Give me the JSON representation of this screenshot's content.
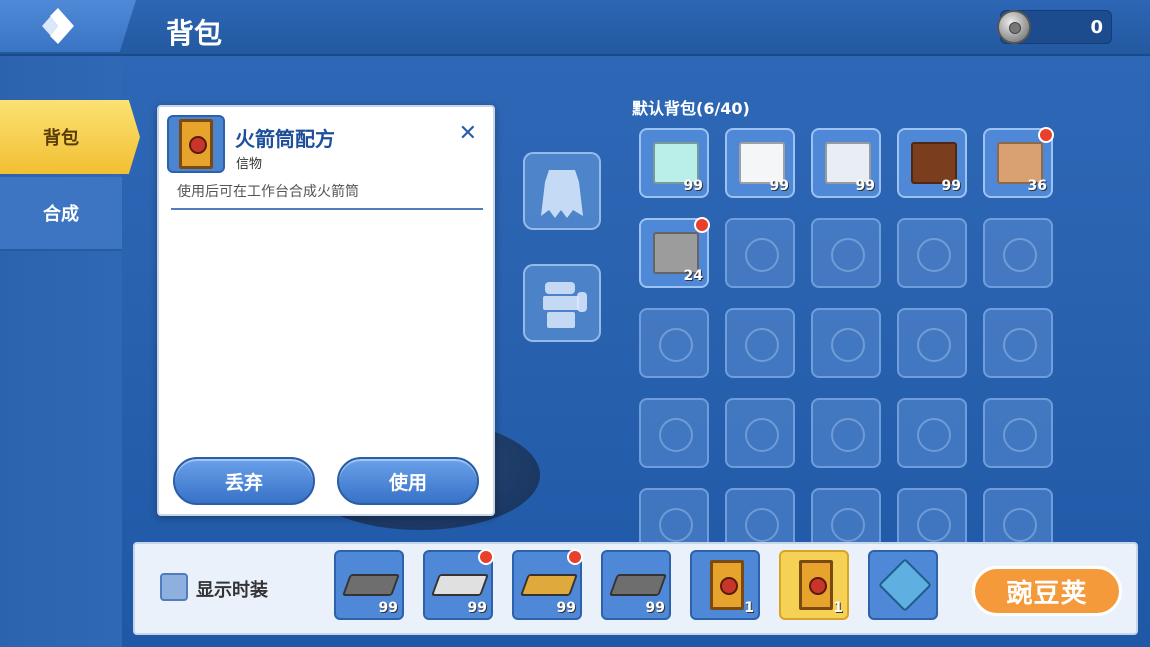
{
  "header": {
    "title": "背包",
    "currency_value": "0"
  },
  "sidebar": {
    "items": [
      {
        "label": "背包"
      },
      {
        "label": "合成"
      }
    ]
  },
  "item_detail": {
    "name": "火箭筒配方",
    "type": "信物",
    "description": "使用后可在工作台合成火箭筒",
    "close_label": "✕",
    "discard_label": "丢弃",
    "use_label": "使用"
  },
  "inventory": {
    "title": "默认背包(6/40)",
    "items": [
      {
        "name": "light-blue-block",
        "count": "99",
        "color": "#b9efe8",
        "badge": false
      },
      {
        "name": "white-block",
        "count": "99",
        "color": "#f4f6f8",
        "badge": false
      },
      {
        "name": "glass-block",
        "count": "99",
        "color": "#e8eef4",
        "badge": false
      },
      {
        "name": "wooden-chest",
        "count": "99",
        "color": "#7a3d1e",
        "badge": false
      },
      {
        "name": "tan-block",
        "count": "36",
        "color": "#d9a171",
        "badge": true
      },
      {
        "name": "gray-block",
        "count": "24",
        "color": "#9c9c9c",
        "badge": true
      }
    ]
  },
  "bottom_bar": {
    "show_fashion_label": "显示时装",
    "hotbar": [
      {
        "name": "iron-ingot",
        "count": "99",
        "color": "#6e6e6e",
        "badge": false
      },
      {
        "name": "silver-ingot",
        "count": "99",
        "color": "#e0e0e0",
        "badge": true
      },
      {
        "name": "gold-ingot",
        "count": "99",
        "color": "#e0a93b",
        "badge": true
      },
      {
        "name": "iron-ingot",
        "count": "99",
        "color": "#6e6e6e",
        "badge": false
      },
      {
        "name": "recipe-book",
        "count": "1",
        "color": "#e7a42d",
        "badge": false
      },
      {
        "name": "recipe-book",
        "count": "1",
        "color": "#e7a42d",
        "badge": false,
        "active": true
      },
      {
        "name": "crystal",
        "count": "",
        "color": "#5fb0e0",
        "badge": false
      }
    ],
    "watermark": "豌豆荚"
  }
}
